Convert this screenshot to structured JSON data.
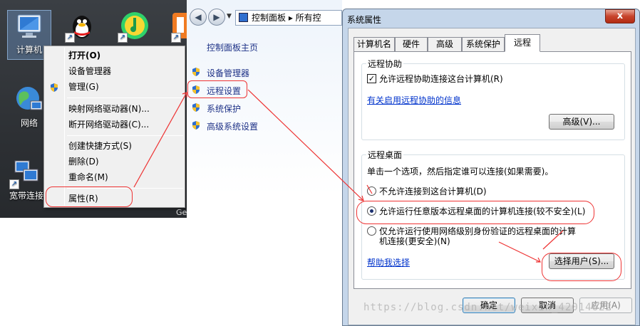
{
  "desktop": {
    "icons": [
      {
        "label": "计算机",
        "icon": "computer-icon"
      },
      {
        "label": "",
        "icon": "qq-penguin-icon"
      },
      {
        "label": "",
        "icon": "music-app-icon"
      },
      {
        "label": "",
        "icon": "orange-app-icon"
      },
      {
        "label": "网络",
        "icon": "network-globe-icon"
      },
      {
        "label": "宽带连接",
        "icon": "broadband-connection-icon"
      }
    ],
    "edge_text": "Ge"
  },
  "context_menu": {
    "items": [
      {
        "label": "打开(O)",
        "bold": true
      },
      {
        "label": "设备管理器"
      },
      {
        "label": "管理(G)",
        "icon": "shield-icon"
      },
      {
        "label": "映射网络驱动器(N)..."
      },
      {
        "label": "断开网络驱动器(C)..."
      },
      {
        "label": "创建快捷方式(S)"
      },
      {
        "label": "删除(D)"
      },
      {
        "label": "重命名(M)"
      },
      {
        "label": "属性(R)"
      }
    ]
  },
  "control_panel": {
    "address": "控制面板 ▸ 所有控",
    "home_link": "控制面板主页",
    "links": [
      {
        "label": "设备管理器",
        "icon": "shield-icon"
      },
      {
        "label": "远程设置",
        "icon": "shield-icon"
      },
      {
        "label": "系统保护",
        "icon": "shield-icon"
      },
      {
        "label": "高级系统设置",
        "icon": "shield-icon"
      }
    ]
  },
  "dialog": {
    "title": "系统属性",
    "close": "x",
    "tabs": [
      "计算机名",
      "硬件",
      "高级",
      "系统保护",
      "远程"
    ],
    "remote_assistance": {
      "group_title": "远程协助",
      "checkbox_label": "允许远程协助连接这台计算机(R)",
      "checked": true,
      "help_link": "有关启用远程协助的信息",
      "advanced_button": "高级(V)..."
    },
    "remote_desktop": {
      "group_title": "远程桌面",
      "description": "单击一个选项，然后指定谁可以连接(如果需要)。",
      "options": [
        {
          "label": "不允许连接到这台计算机(D)",
          "selected": false
        },
        {
          "label": "允许运行任意版本远程桌面的计算机连接(较不安全)(L)",
          "selected": true
        },
        {
          "label": "仅允许运行使用网络级别身份验证的远程桌面的计算机连接(更安全)(N)",
          "selected": false
        }
      ],
      "option3_line1": "仅允许运行使用网络级别身份验证的远程桌面的计算",
      "option3_line2": "机连接(更安全)(N)",
      "help_link": "帮助我选择",
      "select_users_button": "选择用户(S)..."
    },
    "buttons": {
      "ok": "确定",
      "cancel": "取消",
      "apply": "应用(A)"
    }
  },
  "watermark": "https://blog.csdn.net/weixin_42014622",
  "colors": {
    "annotation": "#e33333",
    "link": "#0033cc",
    "dialog_frame": "#c5d6ea"
  }
}
